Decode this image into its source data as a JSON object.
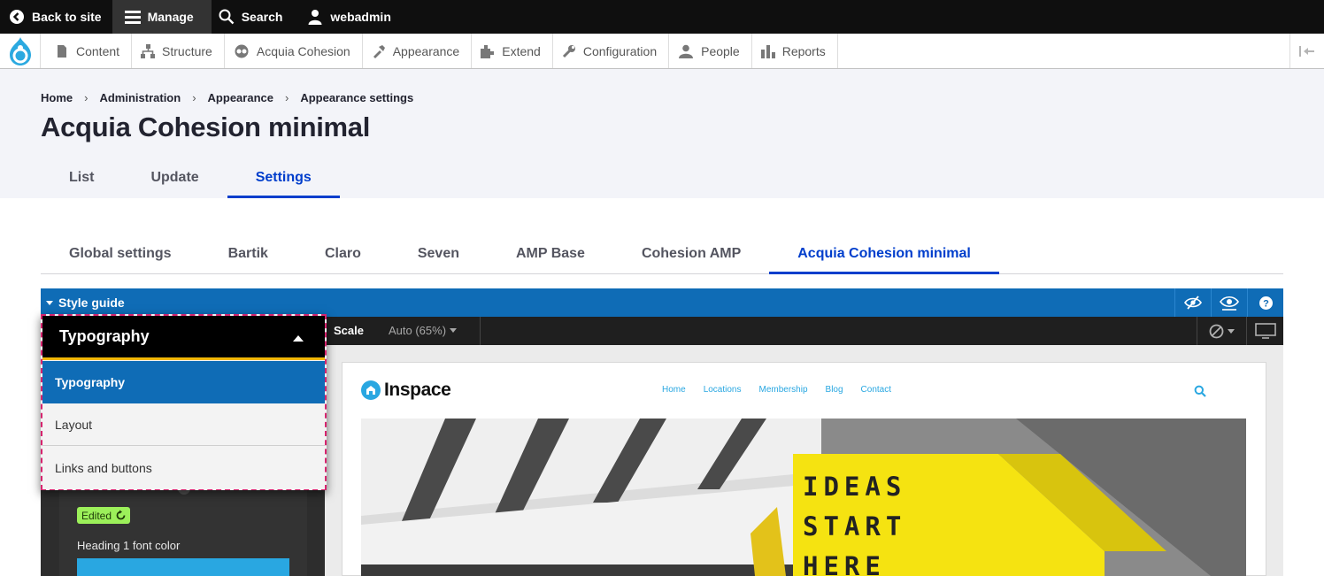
{
  "toolbar": {
    "back_label": "Back to site",
    "manage_label": "Manage",
    "search_label": "Search",
    "user_label": "webadmin"
  },
  "admin_menu": {
    "items": [
      {
        "label": "Content",
        "icon": "content-icon"
      },
      {
        "label": "Structure",
        "icon": "structure-icon"
      },
      {
        "label": "Acquia Cohesion",
        "icon": "cohesion-icon"
      },
      {
        "label": "Appearance",
        "icon": "appearance-icon"
      },
      {
        "label": "Extend",
        "icon": "extend-icon"
      },
      {
        "label": "Configuration",
        "icon": "configuration-icon"
      },
      {
        "label": "People",
        "icon": "people-icon"
      },
      {
        "label": "Reports",
        "icon": "reports-icon"
      }
    ]
  },
  "breadcrumb": [
    "Home",
    "Administration",
    "Appearance",
    "Appearance settings"
  ],
  "page_title": "Acquia Cohesion minimal",
  "primary_tabs": [
    {
      "label": "List",
      "active": false
    },
    {
      "label": "Update",
      "active": false
    },
    {
      "label": "Settings",
      "active": true
    }
  ],
  "secondary_tabs": [
    {
      "label": "Global settings",
      "active": false
    },
    {
      "label": "Bartik",
      "active": false
    },
    {
      "label": "Claro",
      "active": false
    },
    {
      "label": "Seven",
      "active": false
    },
    {
      "label": "AMP Base",
      "active": false
    },
    {
      "label": "Cohesion AMP",
      "active": false
    },
    {
      "label": "Acquia Cohesion minimal",
      "active": true
    }
  ],
  "style_guide": {
    "title": "Style guide",
    "scale_label": "Scale",
    "scale_value": "Auto (65%)",
    "dropdown": {
      "selected": "Typography",
      "options": [
        "Typography",
        "Layout",
        "Links and buttons"
      ]
    },
    "edited_badge": "Edited",
    "field_label": "Heading 1 font color",
    "field_color": "#29a7e1"
  },
  "preview": {
    "site_name": "Inspace",
    "nav": [
      "Home",
      "Locations",
      "Membership",
      "Blog",
      "Contact"
    ],
    "hero_sign": [
      "IDEAS",
      "START",
      "HERE"
    ]
  },
  "colors": {
    "accent_blue": "#003ecc",
    "style_guide_blue": "#0f6cb6",
    "dropdown_highlight": "#f2b705",
    "focus_outline": "#d6246e",
    "edited_green": "#9cf05a"
  }
}
